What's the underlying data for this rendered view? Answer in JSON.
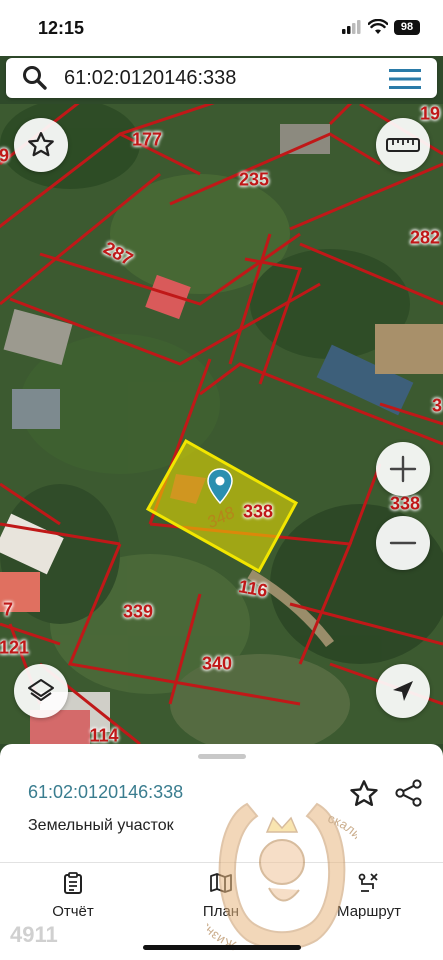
{
  "status": {
    "time": "12:15",
    "battery": "98"
  },
  "search": {
    "query": "61:02:0120146:338"
  },
  "map": {
    "plots": [
      "177",
      "235",
      "287",
      "282",
      "19",
      "3",
      "338",
      "116",
      "339",
      "340",
      "121",
      "114",
      "7",
      "9"
    ],
    "selected_plot_number": "348"
  },
  "sheet": {
    "cadastral_number": "61:02:0120146:338",
    "property_type": "Земельный участок"
  },
  "tabs": [
    {
      "label": "Отчёт",
      "icon": "report-icon"
    },
    {
      "label": "План",
      "icon": "map-icon"
    },
    {
      "label": "Маршрут",
      "icon": "route-icon"
    }
  ],
  "watermark": {
    "text_left": "Жизнь",
    "text_right": "скалится",
    "number": "4911"
  },
  "colors": {
    "accent": "#3a7d8f",
    "boundary": "#c01818",
    "selection": "#f2e600"
  }
}
